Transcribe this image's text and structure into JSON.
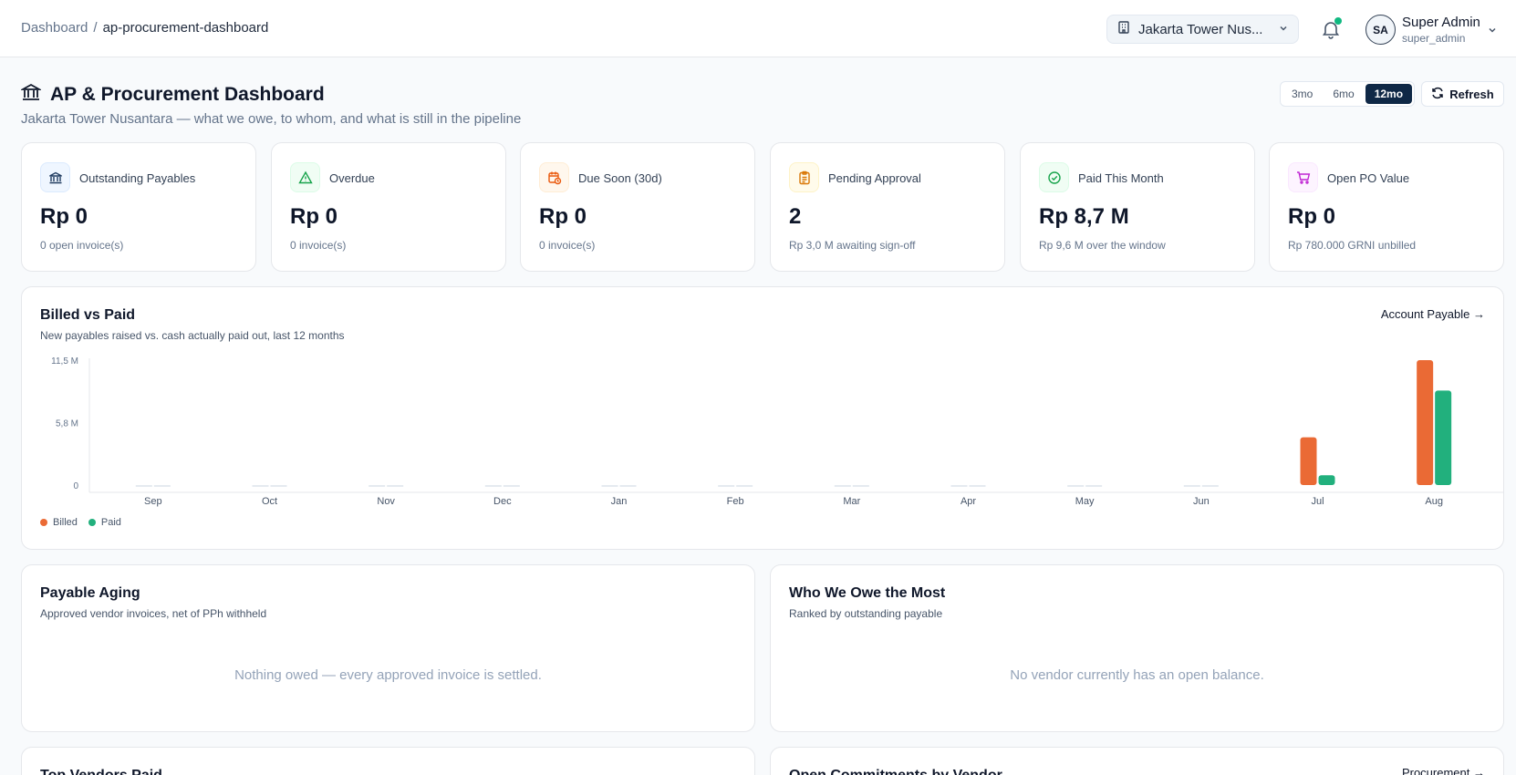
{
  "breadcrumb": {
    "home": "Dashboard",
    "separator": "/",
    "current": "ap-procurement-dashboard"
  },
  "property": {
    "label": "Jakarta Tower Nus..."
  },
  "user": {
    "initials": "SA",
    "name": "Super Admin",
    "role": "super_admin"
  },
  "page": {
    "title": "AP & Procurement Dashboard",
    "subtitle": "Jakarta Tower Nusantara — what we owe, to whom, and what is still in the pipeline"
  },
  "ranges": [
    {
      "label": "3mo",
      "active": false
    },
    {
      "label": "6mo",
      "active": false
    },
    {
      "label": "12mo",
      "active": true
    }
  ],
  "refresh_label": "Refresh",
  "kpis": [
    {
      "label": "Outstanding Payables",
      "value": "Rp 0",
      "sub": "0 open invoice(s)",
      "icon": "bank-icon",
      "color": "#1e3a5f",
      "bg": "#eff6ff"
    },
    {
      "label": "Overdue",
      "value": "Rp 0",
      "sub": "0 invoice(s)",
      "icon": "warning-triangle-icon",
      "color": "#16a34a",
      "bg": "#f0fdf4"
    },
    {
      "label": "Due Soon (30d)",
      "value": "Rp 0",
      "sub": "0 invoice(s)",
      "icon": "calendar-clock-icon",
      "color": "#ea580c",
      "bg": "#fff7ed"
    },
    {
      "label": "Pending Approval",
      "value": "2",
      "sub": "Rp 3,0 M awaiting sign-off",
      "icon": "clipboard-icon",
      "color": "#d97706",
      "bg": "#fffbeb"
    },
    {
      "label": "Paid This Month",
      "value": "Rp 8,7 M",
      "sub": "Rp 9,6 M over the window",
      "icon": "check-circle-icon",
      "color": "#16a34a",
      "bg": "#f0fdf4"
    },
    {
      "label": "Open PO Value",
      "value": "Rp 0",
      "sub": "Rp 780.000 GRNI unbilled",
      "icon": "cart-icon",
      "color": "#c026d3",
      "bg": "#fdf4ff"
    }
  ],
  "billed_vs_paid": {
    "title": "Billed vs Paid",
    "subtitle": "New payables raised vs. cash actually paid out, last 12 months",
    "link": "Account Payable →"
  },
  "chart_data": {
    "type": "bar",
    "categories": [
      "Sep",
      "Oct",
      "Nov",
      "Dec",
      "Jan",
      "Feb",
      "Mar",
      "Apr",
      "May",
      "Jun",
      "Jul",
      "Aug"
    ],
    "series": [
      {
        "name": "Billed",
        "color": "#ea6a35",
        "values": [
          0,
          0,
          0,
          0,
          0,
          0,
          0,
          0,
          0,
          0,
          4.4,
          11.5
        ]
      },
      {
        "name": "Paid",
        "color": "#22b07d",
        "values": [
          0,
          0,
          0,
          0,
          0,
          0,
          0,
          0,
          0,
          0,
          0.9,
          8.7
        ]
      }
    ],
    "ylim": [
      0,
      11.5
    ],
    "yticks": [
      {
        "value": 0,
        "label": "0"
      },
      {
        "value": 5.75,
        "label": "5,8 M"
      },
      {
        "value": 11.5,
        "label": "11,5 M"
      }
    ],
    "legend": "bottom-left"
  },
  "aging": {
    "title": "Payable Aging",
    "subtitle": "Approved vendor invoices, net of PPh withheld",
    "empty": "Nothing owed — every approved invoice is settled."
  },
  "owe_most": {
    "title": "Who We Owe the Most",
    "subtitle": "Ranked by outstanding payable",
    "empty": "No vendor currently has an open balance."
  },
  "top_vendors": {
    "title": "Top Vendors Paid"
  },
  "open_commitments": {
    "title": "Open Commitments by Vendor",
    "link": "Procurement →"
  }
}
